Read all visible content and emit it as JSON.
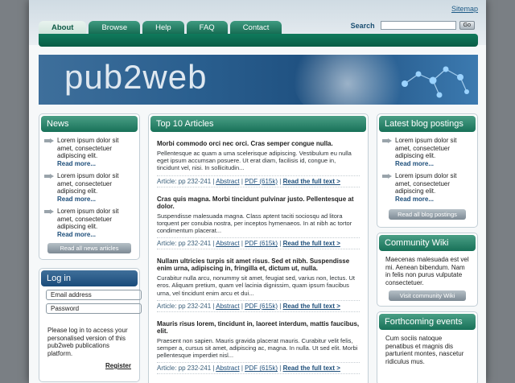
{
  "header": {
    "sitemap": "Sitemap",
    "search_label": "Search",
    "search_value": "",
    "go_label": "Go"
  },
  "nav": {
    "tabs": [
      "About",
      "Browse",
      "Help",
      "FAQ",
      "Contact"
    ]
  },
  "banner": {
    "logo": "pub2web"
  },
  "news": {
    "title": "News",
    "items": [
      {
        "text": "Lorem ipsum dolor sit amet, consectetuer adipiscing elit.",
        "more": "Read more..."
      },
      {
        "text": "Lorem ipsum dolor sit amet, consectetuer adipiscing elit.",
        "more": "Read more..."
      },
      {
        "text": "Lorem ipsum dolor sit amet, consectetuer adipiscing elit.",
        "more": "Read more..."
      }
    ],
    "button": "Read all news articles"
  },
  "login": {
    "title": "Log in",
    "email_placeholder": "Email address",
    "password_placeholder": "Password",
    "info": "Please log in to access your personalised version of this pub2web publications platform.",
    "register": "Register"
  },
  "top10": {
    "title": "Top 10 Articles",
    "articles": [
      {
        "title": "Morbi commodo orci nec orci. Cras semper congue nulla.",
        "body": "Pellentesque ac quam a uma scelerisque adipiscing. Vestibulum eu nulla eget ipsum accumsan posuere. Ut erat diam, facilisis id, congue in, tincidunt vel, nisi. In sollicitudin...",
        "article": "Article: pp 232-241",
        "abstract": "Abstract",
        "pdf": "PDF (615k)",
        "full": "Read the full text >"
      },
      {
        "title": "Cras quis magna. Morbi tincidunt pulvinar justo. Pellentesque at dolor.",
        "body": "Suspendisse malesuada magna. Class aptent taciti sociosqu ad litora torquent per conubia nostra, per inceptos hymenaeos. In at nibh ac tortor condimentum placerat...",
        "article": "Article: pp 232-241",
        "abstract": "Abstract",
        "pdf": "PDF (615k)",
        "full": "Read the full text >"
      },
      {
        "title": "Nullam ultricies turpis sit amet risus. Sed et nibh. Suspendisse enim urna, adipiscing in, fringilla et, dictum ut, nulla.",
        "body": "Curabitur nulla arcu, nonummy sit amet, feugiat sed, varius non, lectus. Ut eros. Aliquam pretium, quam vel lacinia dignissim, quam ipsum faucibus urna, vel tincidunt enim arcu et dui...",
        "article": "Article: pp 232-241",
        "abstract": "Abstract",
        "pdf": "PDF (615k)",
        "full": "Read the full text >"
      },
      {
        "title": "Mauris risus lorem, tincidunt in, laoreet interdum, mattis faucibus, elit.",
        "body": "Praesent non sapien. Mauris gravida placerat mauris. Curabitur velit felis, semper a, cursus sit amet, adipiscing ac, magna. In nulla. Ut sed elit. Morbi pellentesque imperdiet nisl...",
        "article": "Article: pp 232-241",
        "abstract": "Abstract",
        "pdf": "PDF (615k)",
        "full": "Read the full text >"
      }
    ]
  },
  "blog": {
    "title": "Latest blog postings",
    "items": [
      {
        "text": "Lorem ipsum dolor sit amet, consectetuer adipiscing elit.",
        "more": "Read more..."
      },
      {
        "text": "Lorem ipsum dolor sit amet, consectetuer adipiscing elit.",
        "more": "Read more..."
      }
    ],
    "button": "Read all blog postings"
  },
  "wiki": {
    "title": "Community Wiki",
    "text": "Maecenas malesuada est vel mi. Aenean bibendum. Nam in felis non purus vulputate consectetuer.",
    "button": "Visit community Wiki"
  },
  "events": {
    "title": "Forthcoming events",
    "text": "Cum sociis natoque penatibus et magnis dis parturient montes, nascetur ridiculus mus."
  },
  "colors": {
    "green": "#187158",
    "blue": "#1a4b7a",
    "link": "#1d4e7a"
  }
}
